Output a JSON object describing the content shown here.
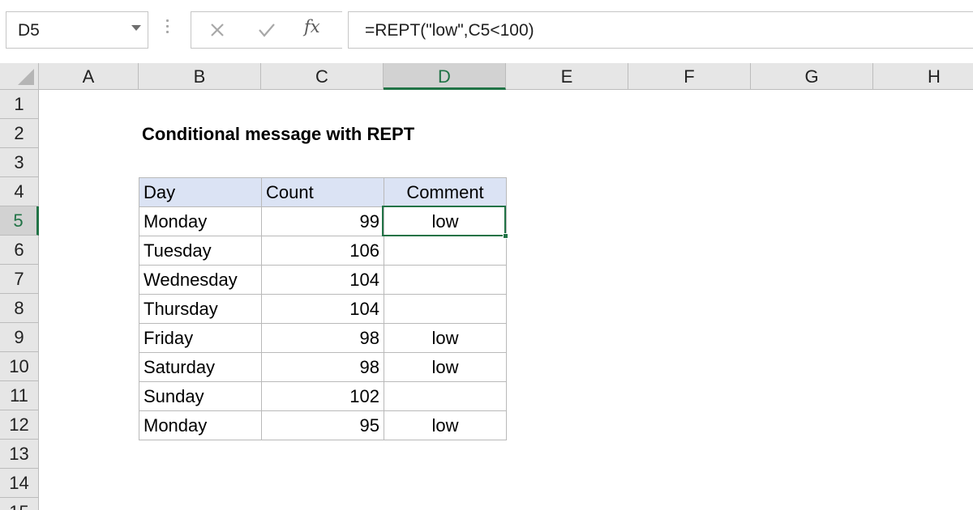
{
  "formula_bar": {
    "name_box": "D5",
    "formula": "=REPT(\"low\",C5<100)",
    "fx_label": "fx",
    "cancel_icon": "close-icon",
    "enter_icon": "checkmark-icon"
  },
  "columns": [
    "A",
    "B",
    "C",
    "D",
    "E",
    "F",
    "G",
    "H"
  ],
  "selected_column": "D",
  "rows": [
    "1",
    "2",
    "3",
    "4",
    "5",
    "6",
    "7",
    "8",
    "9",
    "10",
    "11",
    "12",
    "13",
    "14",
    "15"
  ],
  "selected_row": "5",
  "sheet": {
    "title": "Conditional message with REPT",
    "table": {
      "headers": {
        "day": "Day",
        "count": "Count",
        "comment": "Comment"
      },
      "rows": [
        {
          "day": "Monday",
          "count": "99",
          "comment": "low"
        },
        {
          "day": "Tuesday",
          "count": "106",
          "comment": ""
        },
        {
          "day": "Wednesday",
          "count": "104",
          "comment": ""
        },
        {
          "day": "Thursday",
          "count": "104",
          "comment": ""
        },
        {
          "day": "Friday",
          "count": "98",
          "comment": "low"
        },
        {
          "day": "Saturday",
          "count": "98",
          "comment": "low"
        },
        {
          "day": "Sunday",
          "count": "102",
          "comment": ""
        },
        {
          "day": "Monday",
          "count": "95",
          "comment": "low"
        }
      ]
    }
  },
  "colors": {
    "accent": "#217346",
    "header_fill": "#dbe3f4",
    "grid_header": "#e6e6e6"
  }
}
